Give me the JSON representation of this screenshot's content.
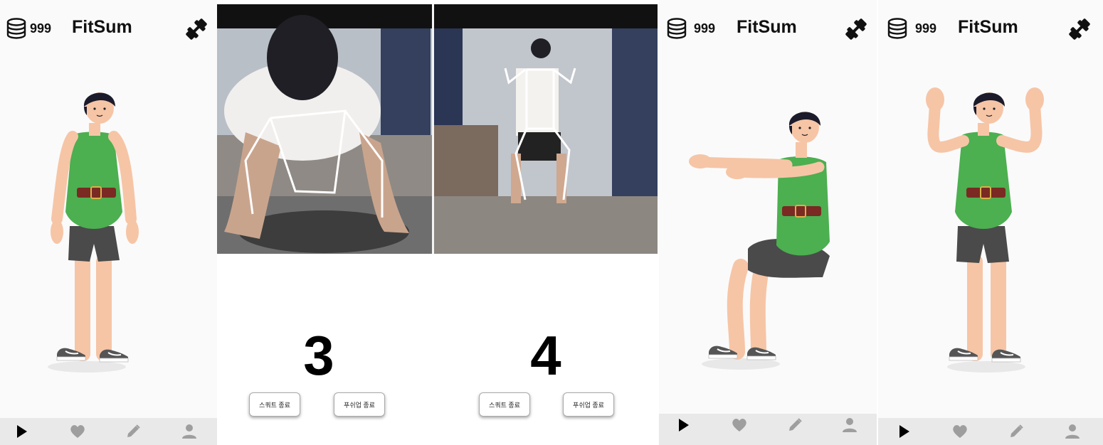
{
  "screens": [
    {
      "coins": "999",
      "title": "FitSum",
      "pose": "standing"
    },
    {
      "coins": "999",
      "title": "FitSum",
      "pose": "squat"
    },
    {
      "coins": "999",
      "title": "FitSum",
      "pose": "arms-up"
    }
  ],
  "workout": {
    "left": {
      "count": "3",
      "end_label": "스쿼트 종료"
    },
    "right": {
      "count": "4",
      "end_label": "푸쉬업 종료"
    }
  },
  "nav_items": [
    "play-icon",
    "heart-icon",
    "pencil-icon",
    "person-icon"
  ],
  "colors": {
    "shirt": "#4caf50",
    "shorts": "#4a4a4a",
    "skin": "#f6c5a6",
    "hair": "#1b1b2b",
    "nav_bg": "#e9e9e9"
  }
}
